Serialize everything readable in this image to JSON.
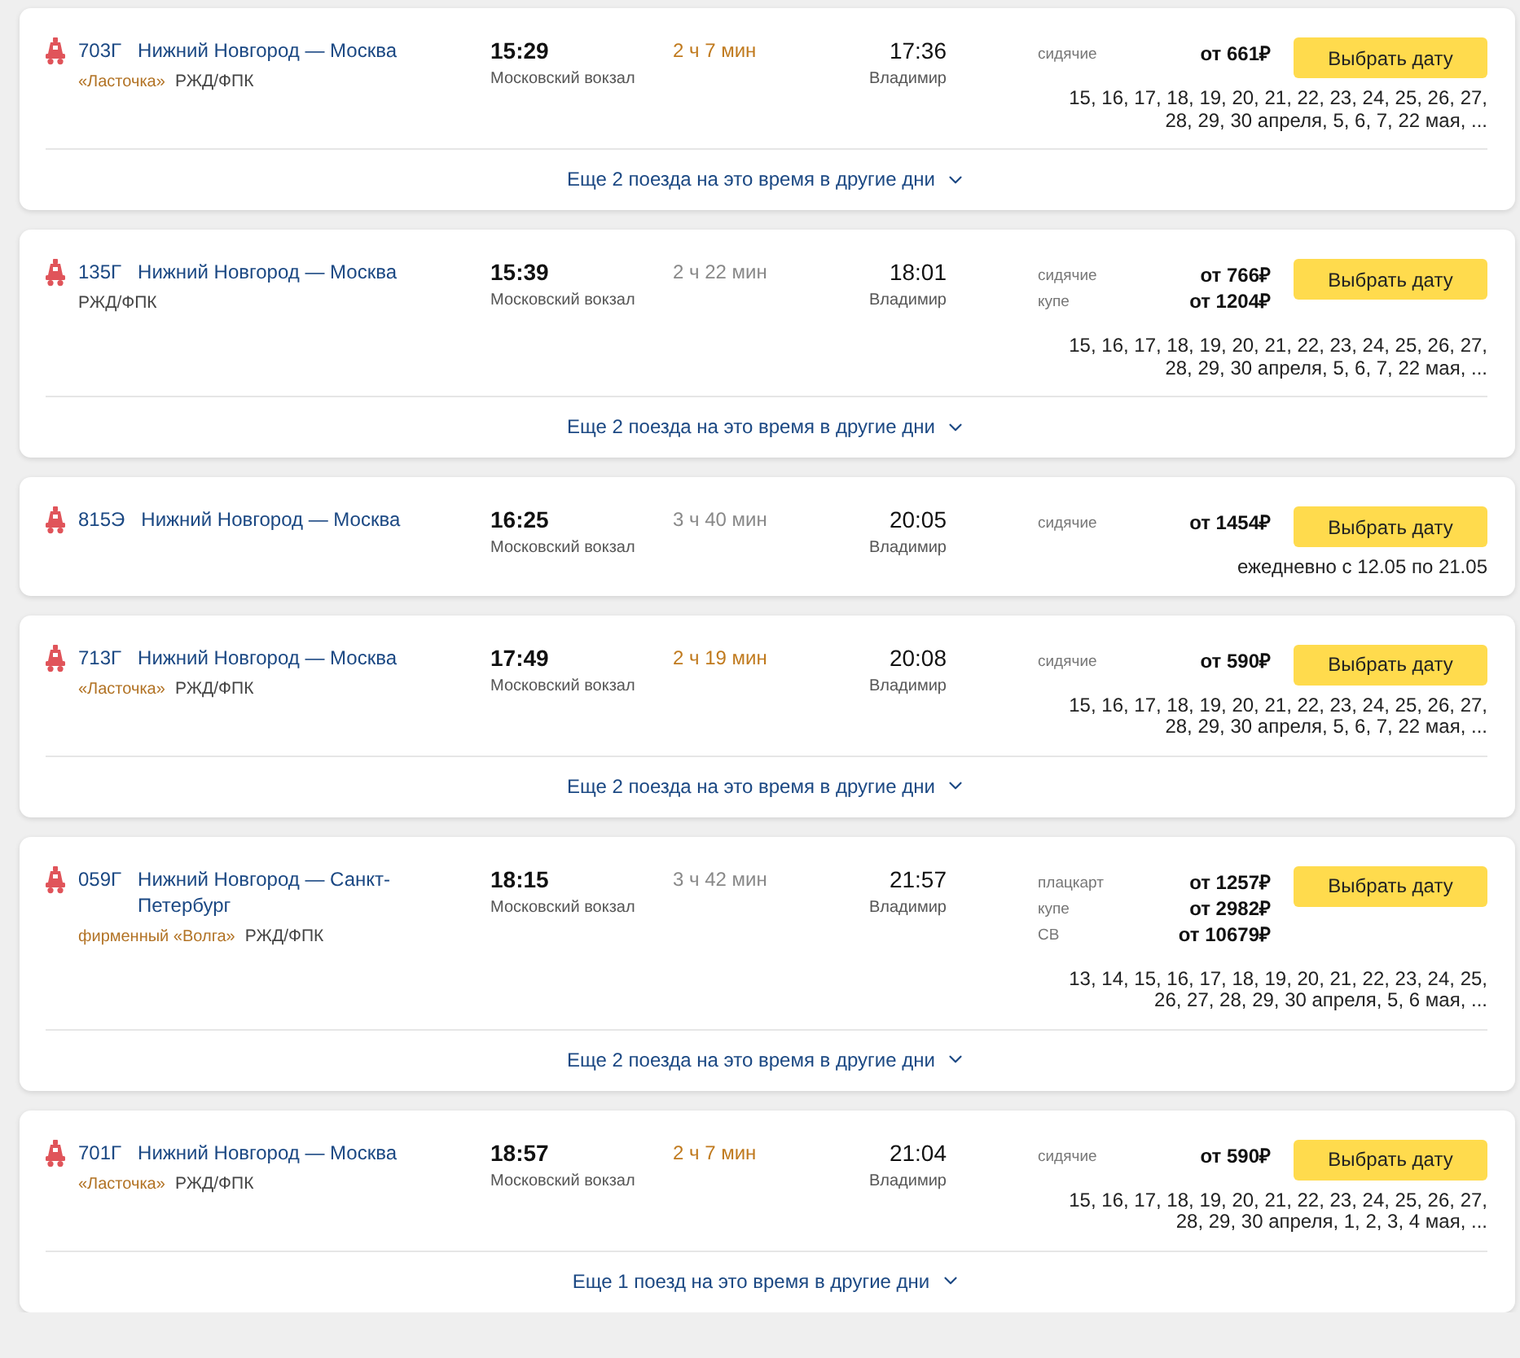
{
  "trains": [
    {
      "number": "703Г",
      "route": "Нижний Новгород — Москва",
      "brand": "«Ласточка»",
      "carrier": "РЖД/ФПК",
      "departure": {
        "time": "15:29",
        "station": "Московский вокзал"
      },
      "duration": {
        "text": "2 ч 7 мин",
        "highlighted": true
      },
      "arrival": {
        "time": "17:36",
        "station": "Владимир"
      },
      "fares": [
        {
          "class": "сидячие",
          "price": "от 661₽"
        }
      ],
      "button": "Выбрать дату",
      "schedule": [
        "15, 16, 17, 18, 19, 20, 21, 22, 23, 24, 25, 26, 27,",
        "28, 29, 30 апреля, 5, 6, 7, 22 мая, ..."
      ],
      "more": "Еще 2 поезда на это время в другие дни"
    },
    {
      "number": "135Г",
      "route": "Нижний Новгород — Москва",
      "carrier": "РЖД/ФПК",
      "departure": {
        "time": "15:39",
        "station": "Московский вокзал"
      },
      "duration": {
        "text": "2 ч 22 мин",
        "highlighted": false
      },
      "arrival": {
        "time": "18:01",
        "station": "Владимир"
      },
      "fares": [
        {
          "class": "сидячие",
          "price": "от 766₽"
        },
        {
          "class": "купе",
          "price": "от 1204₽"
        }
      ],
      "button": "Выбрать дату",
      "schedule": [
        "15, 16, 17, 18, 19, 20, 21, 22, 23, 24, 25, 26, 27,",
        "28, 29, 30 апреля, 5, 6, 7, 22 мая, ..."
      ],
      "more": "Еще 2 поезда на это время в другие дни"
    },
    {
      "number": "815Э",
      "route": "Нижний Новгород — Москва",
      "departure": {
        "time": "16:25",
        "station": "Московский вокзал"
      },
      "duration": {
        "text": "3 ч 40 мин",
        "highlighted": false
      },
      "arrival": {
        "time": "20:05",
        "station": "Владимир"
      },
      "fares": [
        {
          "class": "сидячие",
          "price": "от 1454₽"
        }
      ],
      "button": "Выбрать дату",
      "schedule": [
        "ежедневно с 12.05 по 21.05"
      ]
    },
    {
      "number": "713Г",
      "route": "Нижний Новгород — Москва",
      "brand": "«Ласточка»",
      "carrier": "РЖД/ФПК",
      "departure": {
        "time": "17:49",
        "station": "Московский вокзал"
      },
      "duration": {
        "text": "2 ч 19 мин",
        "highlighted": true
      },
      "arrival": {
        "time": "20:08",
        "station": "Владимир"
      },
      "fares": [
        {
          "class": "сидячие",
          "price": "от 590₽"
        }
      ],
      "button": "Выбрать дату",
      "schedule": [
        "15, 16, 17, 18, 19, 20, 21, 22, 23, 24, 25, 26, 27,",
        "28, 29, 30 апреля, 5, 6, 7, 22 мая, ..."
      ],
      "more": "Еще 2 поезда на это время в другие дни"
    },
    {
      "number": "059Г",
      "route": "Нижний Новгород — Санкт-Петербург",
      "brand": "фирменный «Волга»",
      "carrier": "РЖД/ФПК",
      "departure": {
        "time": "18:15",
        "station": "Московский вокзал"
      },
      "duration": {
        "text": "3 ч 42 мин",
        "highlighted": false
      },
      "arrival": {
        "time": "21:57",
        "station": "Владимир"
      },
      "fares": [
        {
          "class": "плацкарт",
          "price": "от 1257₽"
        },
        {
          "class": "купе",
          "price": "от 2982₽"
        },
        {
          "class": "СВ",
          "price": "от 10679₽"
        }
      ],
      "button": "Выбрать дату",
      "schedule": [
        "13, 14, 15, 16, 17, 18, 19, 20, 21, 22, 23, 24, 25,",
        "26, 27, 28, 29, 30 апреля, 5, 6 мая, ..."
      ],
      "more": "Еще 2 поезда на это время в другие дни"
    },
    {
      "number": "701Г",
      "route": "Нижний Новгород — Москва",
      "brand": "«Ласточка»",
      "carrier": "РЖД/ФПК",
      "departure": {
        "time": "18:57",
        "station": "Московский вокзал"
      },
      "duration": {
        "text": "2 ч 7 мин",
        "highlighted": true
      },
      "arrival": {
        "time": "21:04",
        "station": "Владимир"
      },
      "fares": [
        {
          "class": "сидячие",
          "price": "от 590₽"
        }
      ],
      "button": "Выбрать дату",
      "schedule": [
        "15, 16, 17, 18, 19, 20, 21, 22, 23, 24, 25, 26, 27,",
        "28, 29, 30 апреля, 1, 2, 3, 4 мая, ..."
      ],
      "more": "Еще 1 поезд на это время в другие дни"
    }
  ]
}
